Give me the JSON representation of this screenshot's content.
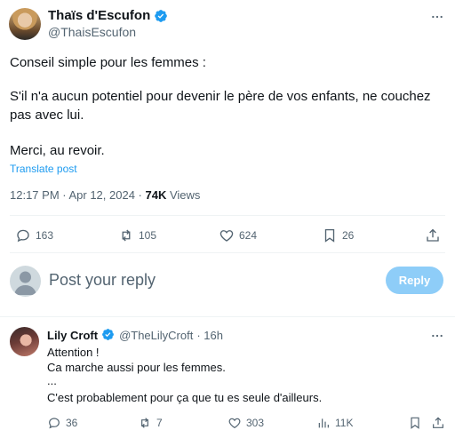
{
  "tweet": {
    "author_name": "Thaïs d'Escufon",
    "author_handle": "@ThaisEscufon",
    "lines": [
      "Conseil simple pour les femmes :",
      "S'il n'a aucun potentiel pour devenir le père de vos enfants, ne couchez",
      "pas avec lui.",
      "Merci, au revoir."
    ],
    "translate_label": "Translate post",
    "timestamp": "12:17 PM · Apr 12, 2024 · ",
    "views_count": "74K",
    "views_label": " Views",
    "actions": {
      "replies": "163",
      "reposts": "105",
      "likes": "624",
      "bookmarks": "26"
    }
  },
  "composer": {
    "placeholder": "Post your reply",
    "reply_button": "Reply"
  },
  "comment": {
    "author_name": "Lily Croft",
    "author_handle": "@TheLilyCroft",
    "time": "· 16h",
    "lines": [
      "Attention !",
      "Ca marche aussi pour les femmes.",
      "...",
      "C'est probablement pour ça que tu es seule d'ailleurs."
    ],
    "actions": {
      "replies": "36",
      "reposts": "7",
      "likes": "303",
      "views": "11K"
    }
  },
  "colors": {
    "accent": "#1d9bf0",
    "secondary_text": "#536471",
    "reply_button_bg": "#8ecdf8"
  },
  "icons": [
    "verified-badge-icon",
    "more-icon",
    "reply-icon",
    "repost-icon",
    "like-icon",
    "bookmark-icon",
    "share-icon",
    "views-icon"
  ]
}
